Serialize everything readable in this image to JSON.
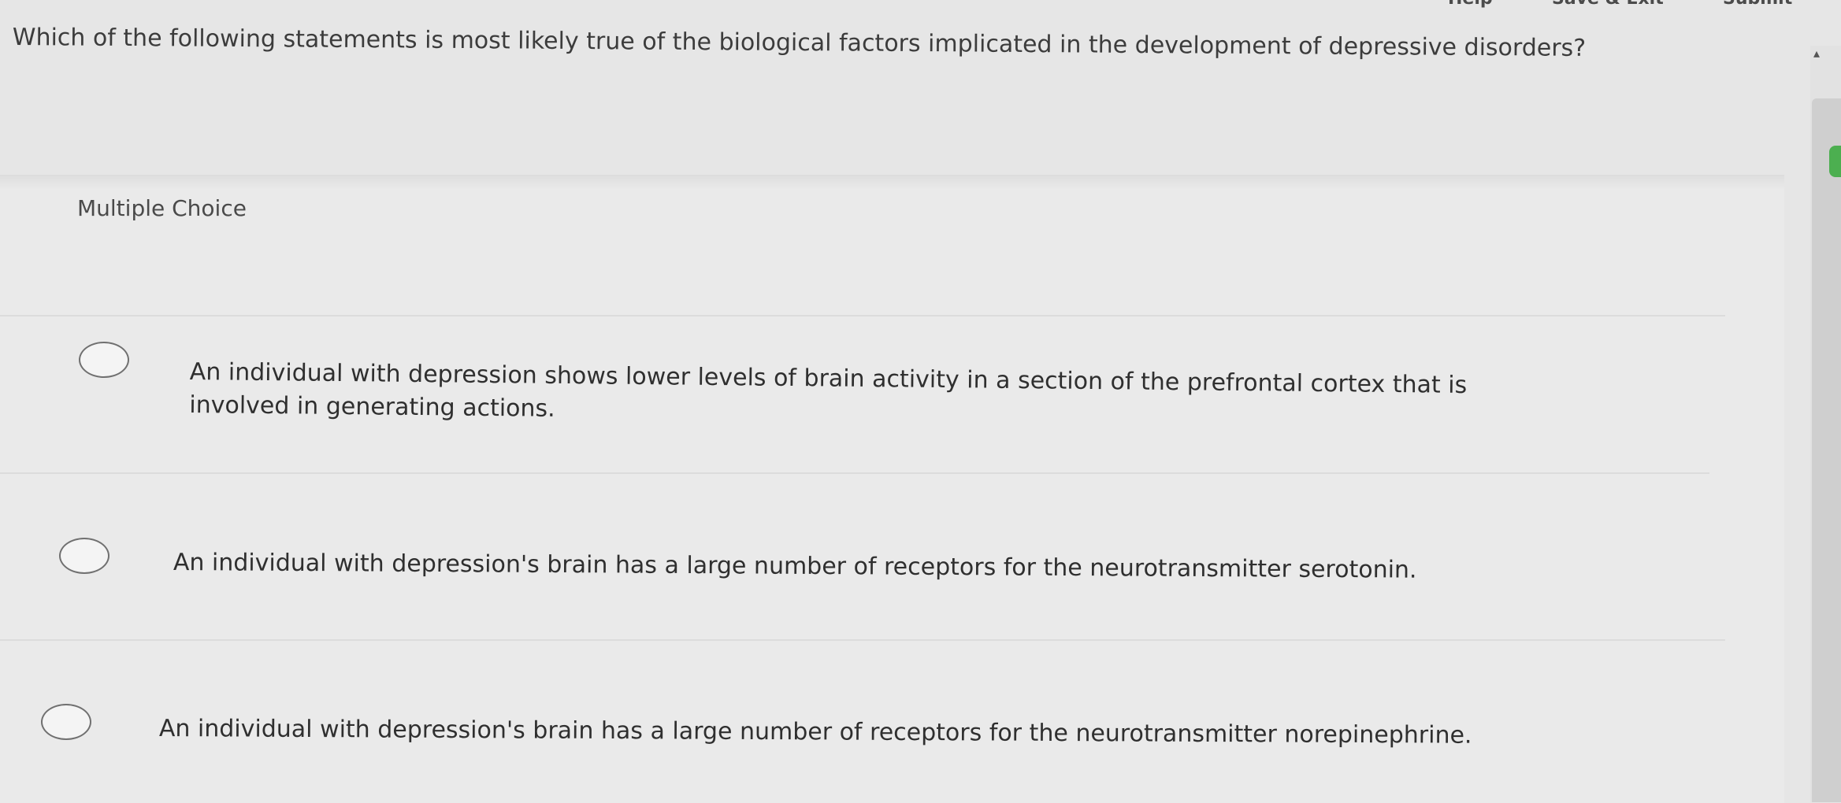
{
  "toolbar": {
    "help_label": "Help",
    "save_exit_label": "Save & Exit",
    "submit_label": "Submit"
  },
  "question": {
    "text": "Which of the following statements is most likely true of the biological factors implicated in the development of depressive disorders?"
  },
  "answer_type": "Multiple Choice",
  "options": [
    {
      "text": "An individual with depression shows lower levels of brain activity in a section of the prefrontal cortex that is involved in generating actions.",
      "selected": false
    },
    {
      "text": "An individual with depression's brain has a large number of receptors for the neurotransmitter serotonin.",
      "selected": false
    },
    {
      "text": "An individual with depression's brain has a large number of receptors for the neurotransmitter norepinephrine.",
      "selected": false
    }
  ],
  "icons": {
    "scroll_up": "chevron-up-icon",
    "radio": "radio-button-icon"
  },
  "colors": {
    "background": "#e6e6e6",
    "text": "#3a3a3a",
    "accent_green": "#4caf50"
  }
}
